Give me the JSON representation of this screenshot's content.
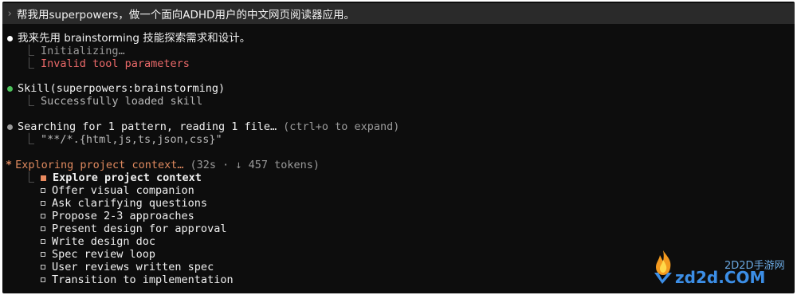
{
  "prompt": {
    "caret": "›",
    "text": "帮我用superpowers，做一个面向ADHD用户的中文网页阅读器应用。"
  },
  "blocks": {
    "brainstorm_intro": {
      "text": "我来先用 brainstorming 技能探索需求和设计。",
      "bullet_color": "#ffffff",
      "children": [
        "Initializing…",
        "Invalid tool parameters"
      ]
    },
    "skill": {
      "text": "Skill(superpowers:brainstorming)",
      "bullet_color": "#4cc25b",
      "child": "Successfully loaded skill"
    },
    "search": {
      "text": "Searching for 1 pattern, reading 1 file…",
      "hint": "(ctrl+o to expand)",
      "bullet_color": "#9a9a9a",
      "child": "\"**/*.{html,js,ts,json,css}\""
    },
    "exploring": {
      "star": "*",
      "text": "Exploring project context…",
      "meta": "(32s · ↓ 457 tokens)",
      "tasks": [
        "Explore project context",
        "Offer visual companion",
        "Ask clarifying questions",
        "Propose 2-3 approaches",
        "Present design for approval",
        "Write design doc",
        "Spec review loop",
        "User reviews written spec",
        "Transition to implementation"
      ]
    }
  },
  "tree_glyph": "⎿",
  "watermark": {
    "line1": "2D2D手游网",
    "line2": "zd2d.COM"
  },
  "colors": {
    "background": "#0d0d0d",
    "prompt_bar": "#2a2a2a",
    "error_red": "#ec6a6a",
    "accent_orange": "#e08a5f",
    "success_green": "#4cc25b"
  }
}
